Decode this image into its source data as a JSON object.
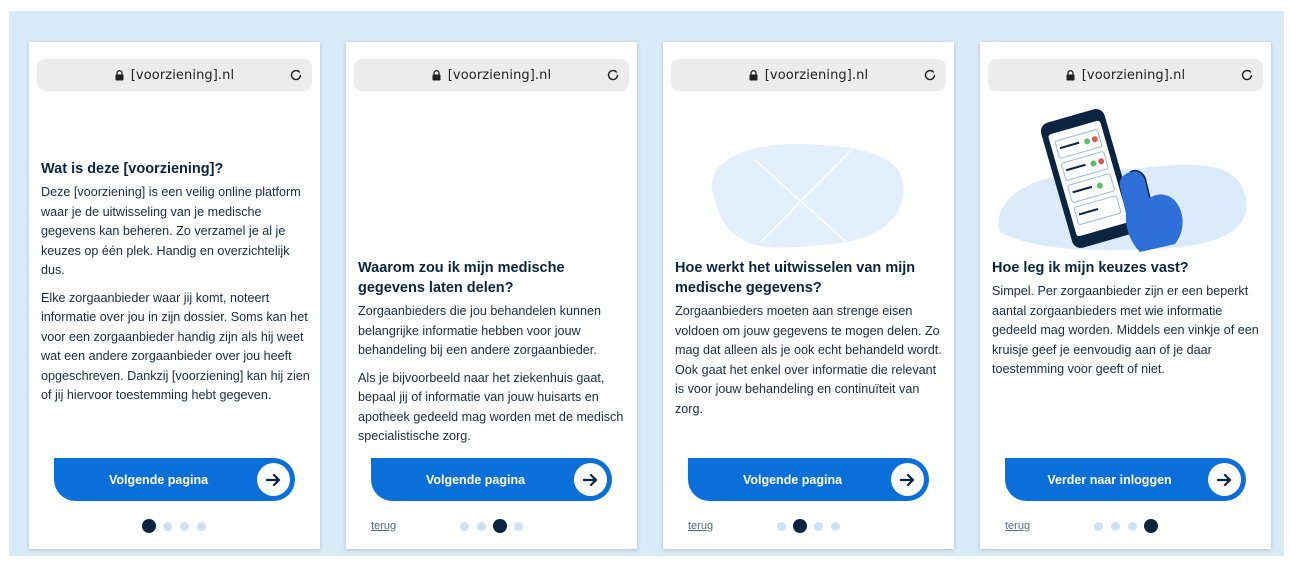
{
  "url": "[voorziening].nl",
  "icons": {
    "lock": "lock-icon",
    "reload": "reload-icon",
    "arrow": "arrow-right-icon"
  },
  "colors": {
    "background": "#d8ebf8",
    "button": "#0b6fd9",
    "heading": "#0b2440",
    "dot_active": "#0b2440",
    "dot_inactive": "#cfe0f3"
  },
  "screens": [
    {
      "heading": "Wat is deze [voorziening]?",
      "paragraphs": [
        "Deze [voorziening] is een veilig online platform waar je de uitwisseling van je medische gegevens kan beheren. Zo verzamel je al je keuzes op één plek. Handig en overzichtelijk dus.",
        "Elke zorgaanbieder waar jij komt, noteert informatie over jou in zijn dossier. Soms kan het voor een zorgaanbieder handig zijn als hij weet wat een andere zorgaanbieder over jou heeft opgeschreven. Dankzij [voorziening] kan hij zien of jij hiervoor toestemming hebt gegeven."
      ],
      "button": "Volgende pagina",
      "back": "",
      "active_dot": 1
    },
    {
      "heading": "Waarom zou ik mijn medische gegevens laten delen?",
      "paragraphs": [
        "Zorgaanbieders die jou behandelen kunnen belangrijke informatie hebben voor jouw behandeling bij een andere zorgaanbieder.",
        "Als je bijvoorbeeld naar het ziekenhuis gaat, bepaal jij of informatie van jouw huisarts en apotheek gedeeld mag worden met de medisch specialistische zorg."
      ],
      "button": "Volgende pagina",
      "back": "terug",
      "active_dot": 3
    },
    {
      "heading": "Hoe werkt het uitwisselen van mijn medische gegevens?",
      "paragraphs": [
        "Zorgaanbieders moeten aan strenge eisen voldoen om jouw gegevens te mogen delen. Zo mag dat alleen als je ook echt behandeld wordt. Ook gaat het enkel over informatie die relevant is voor jouw behandeling en continuïteit van zorg."
      ],
      "button": "Volgende pagina",
      "back": "terug",
      "active_dot": 2
    },
    {
      "heading": "Hoe leg ik mijn keuzes vast?",
      "paragraphs": [
        "Simpel. Per zorgaanbieder zijn er een beperkt aantal zorgaanbieders met wie informatie gedeeld mag worden. Middels een vinkje of een kruisje geef je eenvoudig aan of je daar toestemming voor geeft of niet."
      ],
      "button": "Verder naar inloggen",
      "back": "terug",
      "active_dot": 4
    }
  ]
}
